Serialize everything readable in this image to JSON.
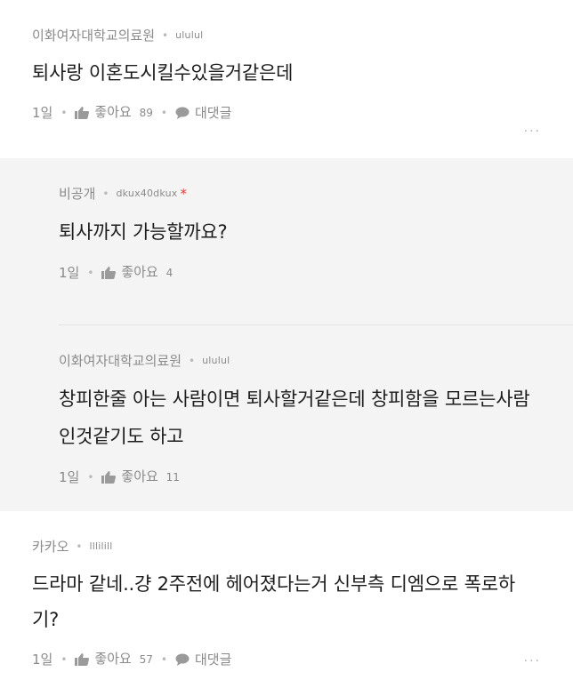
{
  "comments": [
    {
      "school": "이화여자대학교의료원",
      "nickname": "ululul",
      "text": "퇴사랑 이혼도시킬수있을거같은데",
      "time": "1일",
      "like_label": "좋아요",
      "like_count": "89",
      "reply_label": "대댓글",
      "more": "···"
    },
    {
      "school": "카카오",
      "nickname": "lllilill",
      "text": "드라마 같네..걍 2주전에 헤어졌다는거 신부측 디엠으로 폭로하기?",
      "time": "1일",
      "like_label": "좋아요",
      "like_count": "57",
      "reply_label": "대댓글",
      "more": "···"
    }
  ],
  "replies": [
    {
      "school": "비공개",
      "nickname": "dkux40dkux",
      "author_mark": "*",
      "text": "퇴사까지 가능할까요?",
      "time": "1일",
      "like_label": "좋아요",
      "like_count": "4"
    },
    {
      "school": "이화여자대학교의료원",
      "nickname": "ululul",
      "text": "창피한줄 아는 사람이면 퇴사할거같은데 창피함을 모르는사람인것같기도 하고",
      "time": "1일",
      "like_label": "좋아요",
      "like_count": "11"
    }
  ],
  "colors": {
    "meta": "#8a8a8a",
    "reply_bg": "#f4f4f5",
    "author_mark": "#e53935"
  },
  "icons": {
    "like": "thumbs-up-icon",
    "reply": "speech-bubble-icon",
    "more": "more-dots-icon"
  }
}
